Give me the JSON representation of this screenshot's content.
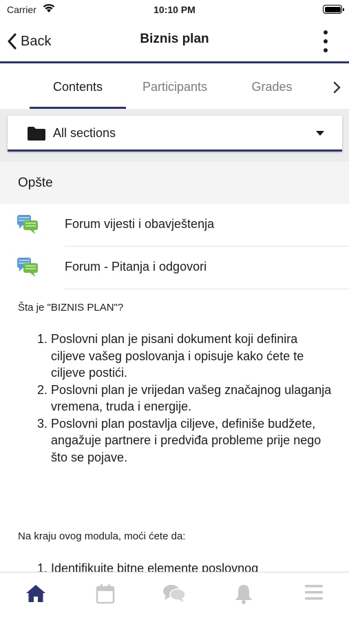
{
  "status_bar": {
    "carrier": "Carrier",
    "time": "10:10 PM"
  },
  "navbar": {
    "back_label": "Back",
    "title": "Biznis plan"
  },
  "tabs": [
    {
      "label": "Contents",
      "active": true
    },
    {
      "label": "Participants",
      "active": false
    },
    {
      "label": "Grades",
      "active": false
    }
  ],
  "section_selector": {
    "value": "All sections"
  },
  "section": {
    "title": "Opšte",
    "modules": [
      {
        "label": "Forum vijesti i obavještenja",
        "icon": "forum-icon"
      },
      {
        "label": "Forum - Pitanja i odgovori",
        "icon": "forum-icon"
      }
    ]
  },
  "summary": {
    "heading": "Šta je \"BIZNIS PLAN\"?",
    "items": [
      "Poslovni plan je pisani dokument koji definira ciljeve vašeg poslovanja i opisuje kako ćete te ciljeve postići.",
      "Poslovni plan je vrijedan vašeg značajnog ulaganja vremena, truda i energije.",
      "Poslovni plan postavlja ciljeve, definiše budžete, angažuje partnere i predviđa probleme prije nego što se pojave."
    ],
    "intro2": "Na kraju ovog modula, moći ćete da:",
    "items2": [
      "Identifikuite bitne elemente poslovnog"
    ]
  },
  "bottom_nav": [
    {
      "name": "home-icon",
      "active": true
    },
    {
      "name": "calendar-icon",
      "active": false
    },
    {
      "name": "messages-icon",
      "active": false
    },
    {
      "name": "notifications-icon",
      "active": false
    },
    {
      "name": "menu-icon",
      "active": false
    }
  ],
  "colors": {
    "accent": "#2e3470",
    "inactive_icon": "#c7c7cc",
    "text": "#1c1c1e"
  }
}
